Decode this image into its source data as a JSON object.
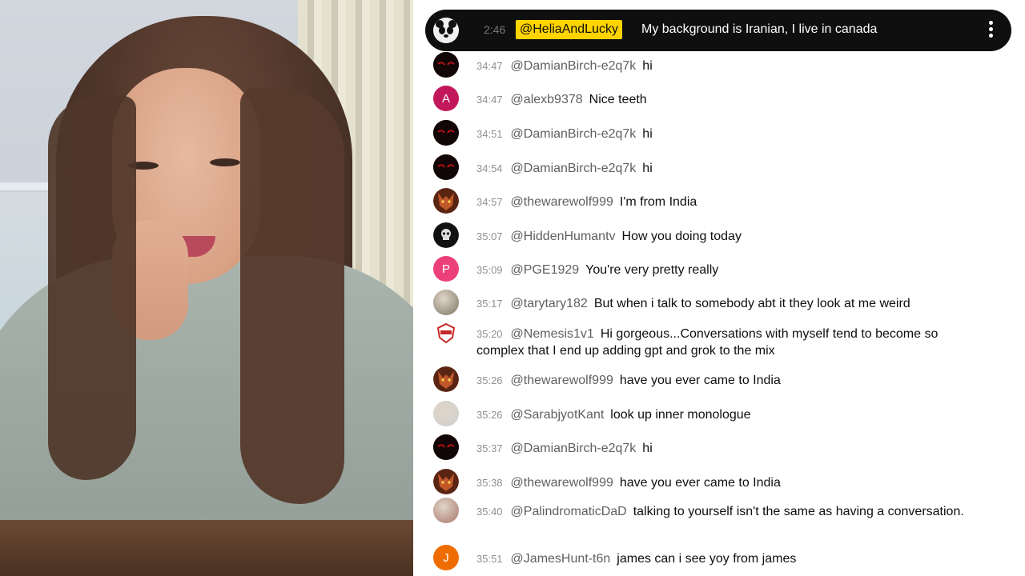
{
  "pinned": {
    "time": "2:46",
    "author": "@HeliaAndLucky",
    "message": "My background is Iranian, I live in canada",
    "avatar_icon": "panda-icon",
    "menu_icon": "more-vert-icon"
  },
  "messages": [
    {
      "time": "34:47",
      "author": "@DamianBirch-e2q7k",
      "text": "hi",
      "avatar": {
        "type": "dark-eyes",
        "color": "#1a0a0a"
      }
    },
    {
      "time": "34:47",
      "author": "@alexb9378",
      "text": "Nice teeth",
      "avatar": {
        "type": "letter",
        "letter": "A",
        "color": "#c2185b"
      }
    },
    {
      "time": "34:51",
      "author": "@DamianBirch-e2q7k",
      "text": "hi",
      "avatar": {
        "type": "dark-eyes",
        "color": "#1a0a0a"
      }
    },
    {
      "time": "34:54",
      "author": "@DamianBirch-e2q7k",
      "text": "hi",
      "avatar": {
        "type": "dark-eyes",
        "color": "#1a0a0a"
      }
    },
    {
      "time": "34:57",
      "author": "@thewarewolf999",
      "text": "I'm from India",
      "avatar": {
        "type": "wolf",
        "color": "#8a3b1e"
      }
    },
    {
      "time": "35:07",
      "author": "@HiddenHumantv",
      "text": "How you doing today",
      "avatar": {
        "type": "skull",
        "color": "#111111"
      }
    },
    {
      "time": "35:09",
      "author": "@PGE1929",
      "text": "You're very pretty really",
      "avatar": {
        "type": "letter",
        "letter": "P",
        "color": "#ec407a"
      }
    },
    {
      "time": "35:17",
      "author": "@tarytary182",
      "text": "But when i talk to somebody abt it they look at me weird",
      "avatar": {
        "type": "photo",
        "color": "#7d7464"
      }
    },
    {
      "time": "35:20",
      "author": "@Nemesis1v1",
      "text": "Hi gorgeous...Conversations with myself tend to become so complex that I end up adding gpt and grok to the mix",
      "avatar": {
        "type": "badge",
        "color": "#ffffff"
      }
    },
    {
      "time": "35:26",
      "author": "@thewarewolf999",
      "text": "have you ever came to India",
      "avatar": {
        "type": "wolf",
        "color": "#8a3b1e"
      }
    },
    {
      "time": "35:26",
      "author": "@SarabjyotKant",
      "text": "look up inner monologue",
      "avatar": {
        "type": "photo",
        "color": "#cfcfcf"
      }
    },
    {
      "time": "35:37",
      "author": "@DamianBirch-e2q7k",
      "text": "hi",
      "avatar": {
        "type": "dark-eyes",
        "color": "#1a0a0a"
      }
    },
    {
      "time": "35:38",
      "author": "@thewarewolf999",
      "text": "have you ever came to India",
      "avatar": {
        "type": "wolf",
        "color": "#8a3b1e"
      }
    },
    {
      "time": "35:40",
      "author": "@PalindromaticDaD",
      "text": "talking to yourself isn't the same as having a conversation.",
      "avatar": {
        "type": "photo",
        "color": "#a8766a"
      }
    },
    {
      "time": "35:51",
      "author": "@JamesHunt-t6n",
      "text": "james can i see yoy from james",
      "avatar": {
        "type": "letter",
        "letter": "J",
        "color": "#ef6c00"
      }
    }
  ]
}
